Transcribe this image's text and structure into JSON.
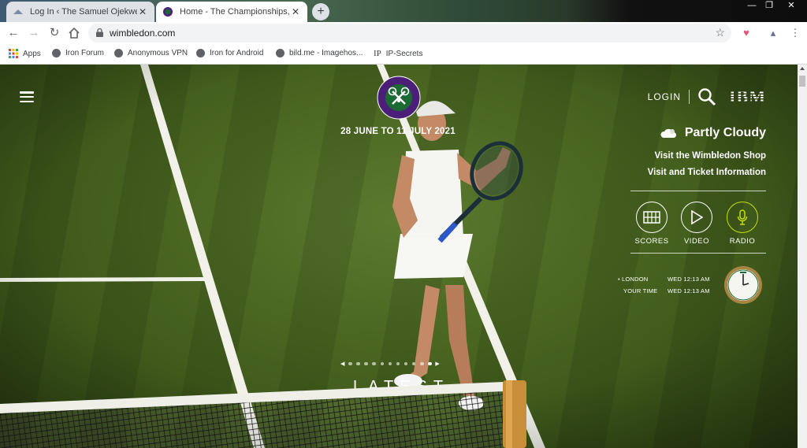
{
  "browser": {
    "tabs": [
      {
        "title": "Log In ‹ The Samuel Ojekwe Blog",
        "active": false
      },
      {
        "title": "Home - The Championships, Wimbledon",
        "active": true
      }
    ],
    "newtab": "+",
    "window_controls": [
      "—",
      "❐",
      "✕"
    ],
    "url": "wimbledon.com",
    "bookmarks": [
      "Apps",
      "Iron Forum",
      "Anonymous VPN",
      "Iron for Android",
      "bild.me - Imagehos...",
      "IP-Secrets"
    ],
    "bookmark_ip_prefix": "IP"
  },
  "site": {
    "dates": "28 JUNE TO 11 JULY 2021",
    "login": "LOGIN",
    "ibm": "IBM",
    "weather": "Partly Cloudy",
    "shop_link": "Visit the Wimbledon Shop",
    "info_link": "Visit and Ticket Information",
    "media": [
      {
        "label": "SCORES",
        "icon": "scoreboard-icon"
      },
      {
        "label": "VIDEO",
        "icon": "play-icon"
      },
      {
        "label": "RADIO",
        "icon": "microphone-icon"
      }
    ],
    "times": [
      {
        "place": "• LONDON",
        "time": "WED 12:13 AM"
      },
      {
        "place": "YOUR TIME",
        "time": "WED 12:13 AM"
      }
    ],
    "carousel": {
      "count": 11,
      "active_index": 10
    },
    "latest": "LATEST",
    "colors": {
      "radio_ring": "#c8e000",
      "logo_purple": "#4b1f78",
      "logo_green": "#1b6a34"
    }
  }
}
